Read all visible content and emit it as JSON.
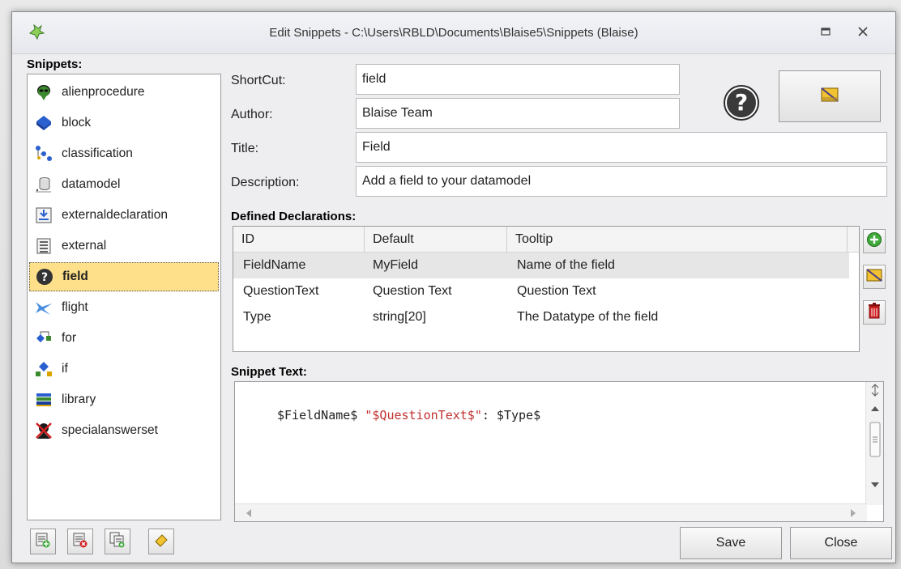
{
  "window": {
    "title": "Edit Snippets - C:\\Users\\RBLD\\Documents\\Blaise5\\Snippets (Blaise)"
  },
  "snippets": {
    "label": "Snippets:",
    "items": [
      {
        "label": "alienprocedure",
        "icon": "alien-icon"
      },
      {
        "label": "block",
        "icon": "block-icon"
      },
      {
        "label": "classification",
        "icon": "classification-icon"
      },
      {
        "label": "datamodel",
        "icon": "datamodel-icon"
      },
      {
        "label": "externaldeclaration",
        "icon": "external-declaration-icon"
      },
      {
        "label": "external",
        "icon": "external-icon"
      },
      {
        "label": "field",
        "icon": "question-icon"
      },
      {
        "label": "flight",
        "icon": "flight-icon"
      },
      {
        "label": "for",
        "icon": "for-icon"
      },
      {
        "label": "if",
        "icon": "if-icon"
      },
      {
        "label": "library",
        "icon": "library-icon"
      },
      {
        "label": "specialanswerset",
        "icon": "specialanswerset-icon"
      }
    ],
    "selected": "field"
  },
  "form": {
    "shortcut_label": "ShortCut:",
    "shortcut_value": "field",
    "author_label": "Author:",
    "author_value": "Blaise Team",
    "title_label": "Title:",
    "title_value": "Field",
    "description_label": "Description:",
    "description_value": "Add a field to your datamodel"
  },
  "declarations": {
    "label": "Defined Declarations:",
    "columns": [
      "ID",
      "Default",
      "Tooltip"
    ],
    "rows": [
      [
        "FieldName",
        "MyField",
        "Name of the field"
      ],
      [
        "QuestionText",
        "Question Text",
        "Question Text"
      ],
      [
        "Type",
        "string[20]",
        "The Datatype of the field"
      ]
    ]
  },
  "snippet_text": {
    "label": "Snippet Text:",
    "code_prefix": "$FieldName$ ",
    "code_string": "\"$QuestionText$\"",
    "code_suffix": ": $Type$"
  },
  "buttons": {
    "save": "Save",
    "close": "Close"
  },
  "colors": {
    "selected_item": "#fde089",
    "window_bg": "#eeeef0",
    "string_literal": "#c03030"
  }
}
